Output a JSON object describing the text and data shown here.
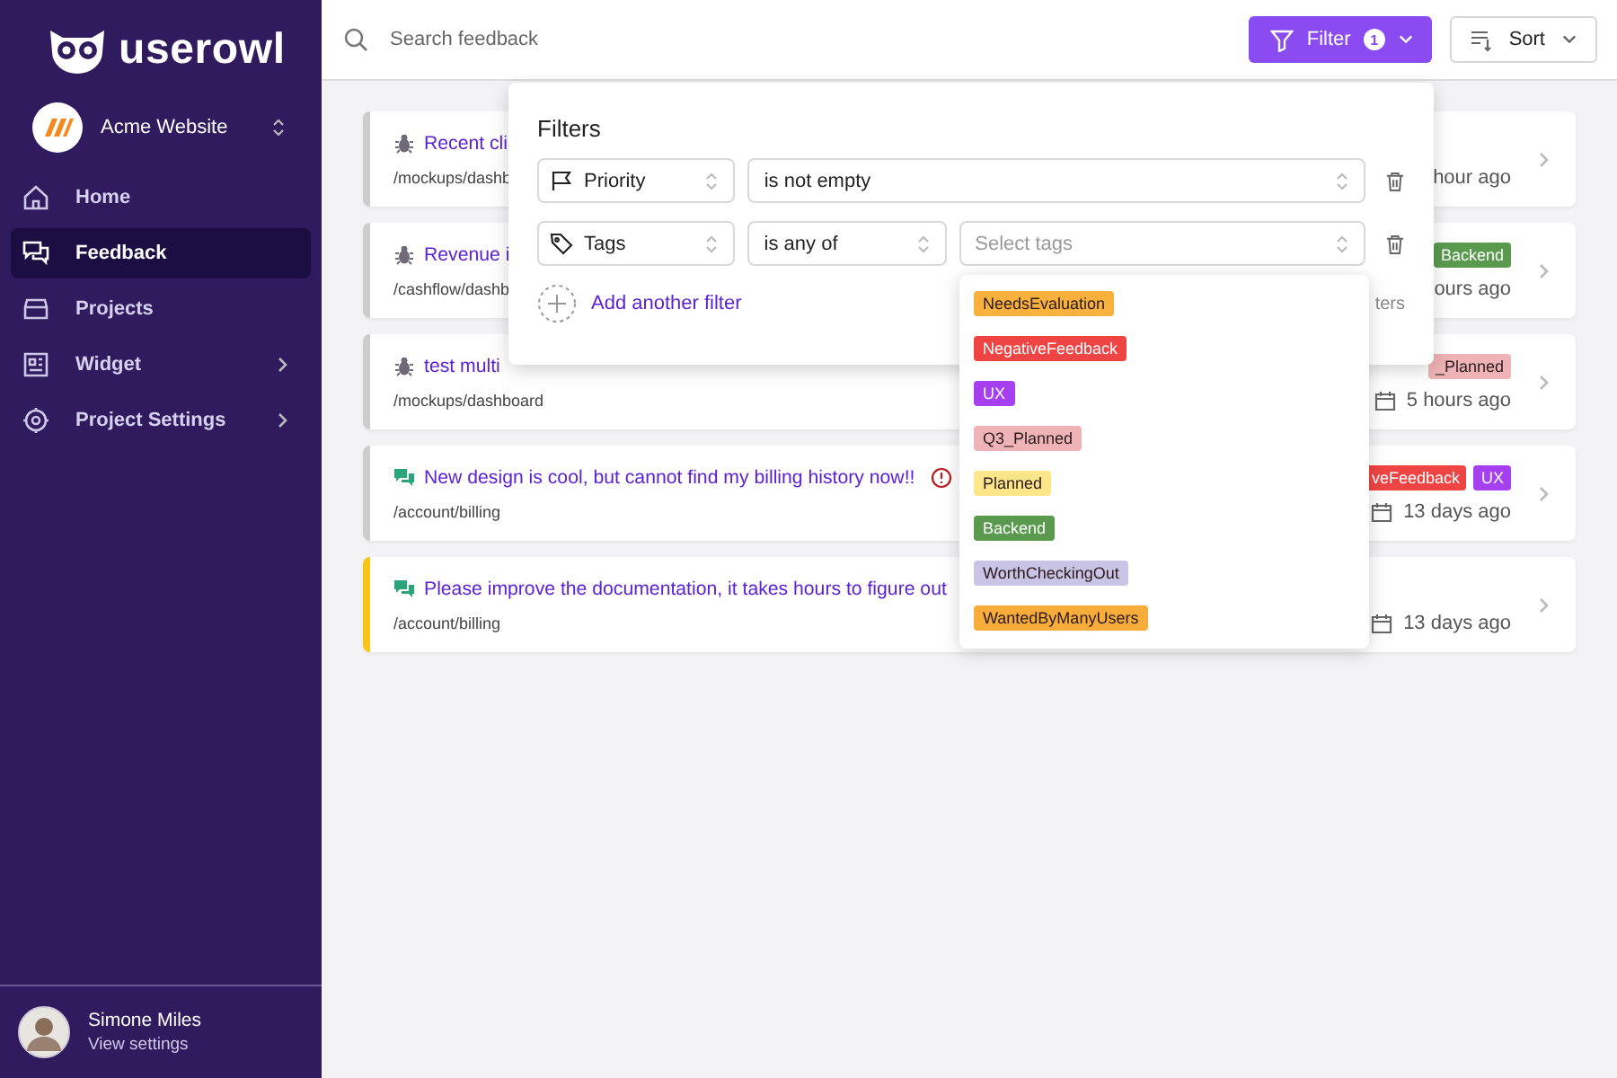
{
  "sidebar": {
    "logo": "userowl",
    "project": {
      "name": "Acme Website"
    },
    "items": [
      {
        "label": "Home",
        "selected": false,
        "has_submenu": false
      },
      {
        "label": "Feedback",
        "selected": true,
        "has_submenu": false
      },
      {
        "label": "Projects",
        "selected": false,
        "has_submenu": false
      },
      {
        "label": "Widget",
        "selected": false,
        "has_submenu": true
      },
      {
        "label": "Project Settings",
        "selected": false,
        "has_submenu": true
      }
    ],
    "user": {
      "name": "Simone Miles",
      "link": "View settings"
    }
  },
  "header": {
    "search": {
      "placeholder": "Search feedback"
    },
    "filter_button": {
      "label": "Filter",
      "count": "1"
    },
    "sort_button": {
      "label": "Sort"
    }
  },
  "feedback": [
    {
      "kind": "bug",
      "title": "Recent cli",
      "path": "/mockups/dashb",
      "alert": false,
      "color": "#cccccc",
      "calendar_icon": false,
      "time": "hour ago"
    },
    {
      "kind": "bug",
      "title": "Revenue i",
      "path": "/cashflow/dashb",
      "alert": false,
      "color": "#cccccc",
      "tags": [
        {
          "label": "Backend",
          "color": "#5a9a4f"
        }
      ],
      "calendar_icon": false,
      "time": "ours ago"
    },
    {
      "kind": "bug",
      "title": "test multi",
      "path": "/mockups/dashboard",
      "alert": false,
      "color": "#cccccc",
      "tags": [
        {
          "label": "_Planned",
          "color": "#eeb3b6"
        }
      ],
      "calendar_icon": true,
      "time": "5 hours ago"
    },
    {
      "kind": "message",
      "title": "New design is cool, but cannot find my billing history now!!",
      "path": "/account/billing",
      "alert": true,
      "color": "#cccccc",
      "tags": [
        {
          "label": "veFeedback",
          "color": "#ef4444"
        },
        {
          "label": "UX",
          "color": "#a63ff0"
        }
      ],
      "calendar_icon": true,
      "time": "13 days ago"
    },
    {
      "kind": "message",
      "title": "Please improve the documentation, it takes hours to figure out",
      "path": "/account/billing",
      "alert": false,
      "color": "#f5c518",
      "calendar_icon": true,
      "time": "13 days ago"
    }
  ],
  "filters_popover": {
    "title": "Filters",
    "rows": [
      {
        "field": "Priority",
        "operator": "is not empty"
      },
      {
        "field": "Tags",
        "operator": "is any of",
        "value_placeholder": "Select tags"
      }
    ],
    "add_label": "Add another filter",
    "clear_fragment": "ters"
  },
  "tag_dropdown": [
    {
      "label": "NeedsEvaluation",
      "color": "#f8b13d"
    },
    {
      "label": "NegativeFeedback",
      "color": "#ef4444"
    },
    {
      "label": "UX",
      "color": "#a63ff0"
    },
    {
      "label": "Q3_Planned",
      "color": "#eeb3b6"
    },
    {
      "label": "Planned",
      "color": "#fde68a"
    },
    {
      "label": "Backend",
      "color": "#5a9a4f"
    },
    {
      "label": "WorthCheckingOut",
      "color": "#c9c3e6"
    },
    {
      "label": "WantedByManyUsers",
      "color": "#f8ac3a"
    }
  ]
}
